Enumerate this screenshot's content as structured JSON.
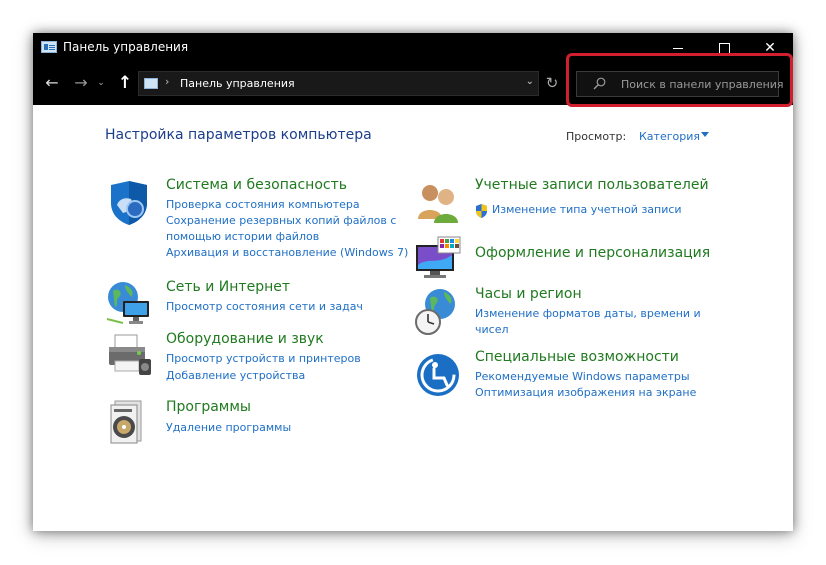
{
  "window": {
    "title": "Панель управления",
    "controls": {
      "minimize": "minimize",
      "maximize": "maximize",
      "close": "✕"
    }
  },
  "navbar": {
    "back": "←",
    "forward": "→",
    "recent": "⌄",
    "up": "↑",
    "address_sep": "›",
    "address": "Панель управления",
    "address_dropdown": "⌄",
    "refresh": "↻",
    "search_placeholder": "Поиск в панели управления"
  },
  "header": {
    "title": "Настройка параметров компьютера",
    "view_label": "Просмотр:",
    "view_value": "Категория"
  },
  "categories_left": [
    {
      "title": "Система и безопасность",
      "icon": "shield-icon",
      "links": [
        "Проверка состояния компьютера",
        "Сохранение резервных копий файлов с",
        "помощью истории файлов",
        "Архивация и восстановление (Windows 7)"
      ]
    },
    {
      "title": "Сеть и Интернет",
      "icon": "network-globe-icon",
      "links": [
        "Просмотр состояния сети и задач"
      ]
    },
    {
      "title": "Оборудование и звук",
      "icon": "printer-icon",
      "links": [
        "Просмотр устройств и принтеров",
        "Добавление устройства"
      ]
    },
    {
      "title": "Программы",
      "icon": "programs-disc-icon",
      "links": [
        "Удаление программы"
      ]
    }
  ],
  "categories_right": [
    {
      "title": "Учетные записи пользователей",
      "icon": "users-icon",
      "links": [
        "Изменение типа учетной записи"
      ]
    },
    {
      "title": "Оформление и персонализация",
      "icon": "monitor-palette-icon",
      "links": []
    },
    {
      "title": "Часы и регион",
      "icon": "clock-globe-icon",
      "links": [
        "Изменение форматов даты, времени и",
        "чисел"
      ]
    },
    {
      "title": "Специальные возможности",
      "icon": "accessibility-icon",
      "links": [
        "Рекомендуемые Windows параметры",
        "Оптимизация изображения на экране"
      ]
    }
  ],
  "colors": {
    "titlebar": "#000000",
    "category_title": "#207a20",
    "link": "#1f6fc5",
    "page_title": "#1c3f8c",
    "highlight": "#d02030"
  }
}
